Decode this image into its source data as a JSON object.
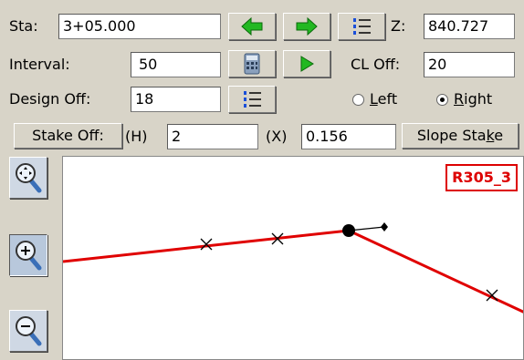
{
  "station": {
    "label": "Sta:",
    "value": "3+05.000"
  },
  "elevation": {
    "label": "Z:",
    "value": "840.727"
  },
  "interval": {
    "label": "Interval:",
    "value": "50"
  },
  "cl_offset": {
    "label": "CL Off:",
    "value": "20"
  },
  "design_offset": {
    "label": "Design Off:",
    "value": "18"
  },
  "side": {
    "left": {
      "underline": "L",
      "rest": "eft",
      "selected": false
    },
    "right": {
      "underline": "R",
      "rest": "ight",
      "selected": true
    }
  },
  "stake_offset": {
    "button_label": "Stake Off:",
    "h_label": "(H)",
    "h_value": "2",
    "x_label": "(X)",
    "x_value": "0.156"
  },
  "slope_stake": {
    "prefix": "Slope Sta",
    "underline": "k",
    "suffix": "e"
  },
  "alignment_tag": "R305_3",
  "icons": {
    "prev": "left-arrow-icon",
    "next": "right-arrow-icon",
    "list1": "numbered-list-icon",
    "calc": "calculator-icon",
    "play": "play-icon",
    "list2": "numbered-list-icon",
    "zoom_extents": "zoom-extents-icon",
    "zoom_in": "zoom-in-icon",
    "zoom_out": "zoom-out-icon"
  },
  "colors": {
    "profile_line": "#e00000",
    "alignment_tag": "#dd0000",
    "arrow_green": "#22b822"
  }
}
